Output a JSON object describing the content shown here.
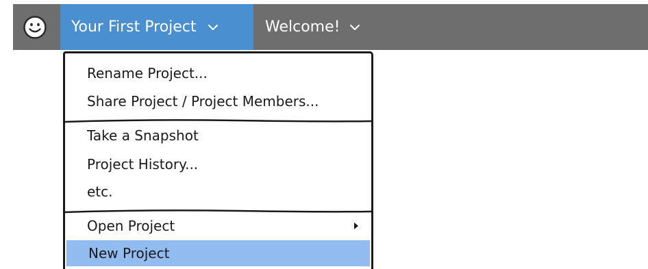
{
  "topbar": {
    "logo_icon": "smiley-face-icon",
    "tabs": [
      {
        "label": "Your First Project",
        "icon": "chevron-down-icon",
        "active": true
      },
      {
        "label": "Welcome!",
        "icon": "chevron-down-icon",
        "active": false
      }
    ]
  },
  "project_menu": {
    "groups": [
      [
        "Rename Project...",
        "Share Project / Project Members..."
      ],
      [
        "Take a Snapshot",
        "Project History...",
        "etc."
      ],
      [
        "Open Project",
        "New Project"
      ]
    ],
    "submenu_icon": "triangle-right-icon",
    "selected_item": "New Project"
  },
  "colors": {
    "topbar": "#6e6e6e",
    "active_tab": "#4a90d0",
    "selected_item": "#92bbef",
    "text": "#1a1a1a"
  }
}
